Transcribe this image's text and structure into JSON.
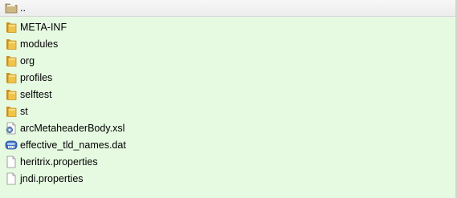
{
  "file_list": {
    "parent_entry": {
      "label": "..",
      "icon": "folder-up-icon"
    },
    "entries": [
      {
        "label": "META-INF",
        "type": "folder",
        "icon": "folder-icon"
      },
      {
        "label": "modules",
        "type": "folder",
        "icon": "folder-icon"
      },
      {
        "label": "org",
        "type": "folder",
        "icon": "folder-icon"
      },
      {
        "label": "profiles",
        "type": "folder",
        "icon": "folder-icon"
      },
      {
        "label": "selftest",
        "type": "folder",
        "icon": "folder-icon"
      },
      {
        "label": "st",
        "type": "folder",
        "icon": "folder-icon"
      },
      {
        "label": "arcMetaheaderBody.xsl",
        "type": "xsl-file",
        "icon": "xsl-file-icon"
      },
      {
        "label": "effective_tld_names.dat",
        "type": "dat-file",
        "icon": "dat-file-icon"
      },
      {
        "label": "heritrix.properties",
        "type": "file",
        "icon": "document-icon"
      },
      {
        "label": "jndi.properties",
        "type": "file",
        "icon": "document-icon"
      }
    ]
  },
  "colors": {
    "background": "#e6fae2",
    "folder": "#e8b93c",
    "header_row": "#efefef"
  }
}
